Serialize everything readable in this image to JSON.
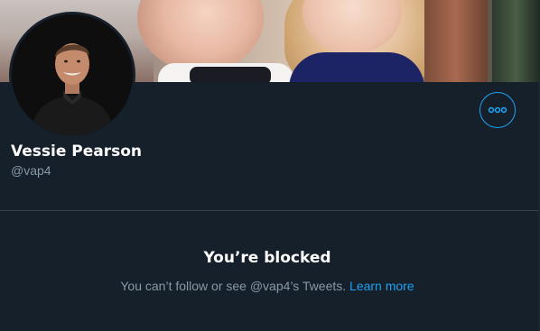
{
  "profile": {
    "name": "Vessie Pearson",
    "handle": "@vap4"
  },
  "actions": {
    "more_icon": "more-horizontal-icon"
  },
  "blocked": {
    "title": "You’re blocked",
    "message": "You can’t follow or see @vap4’s Tweets.",
    "learn_more": "Learn more"
  },
  "colors": {
    "background": "#15202b",
    "accent": "#1da1f2",
    "secondary_text": "#8899a6",
    "divider": "#38444d"
  }
}
